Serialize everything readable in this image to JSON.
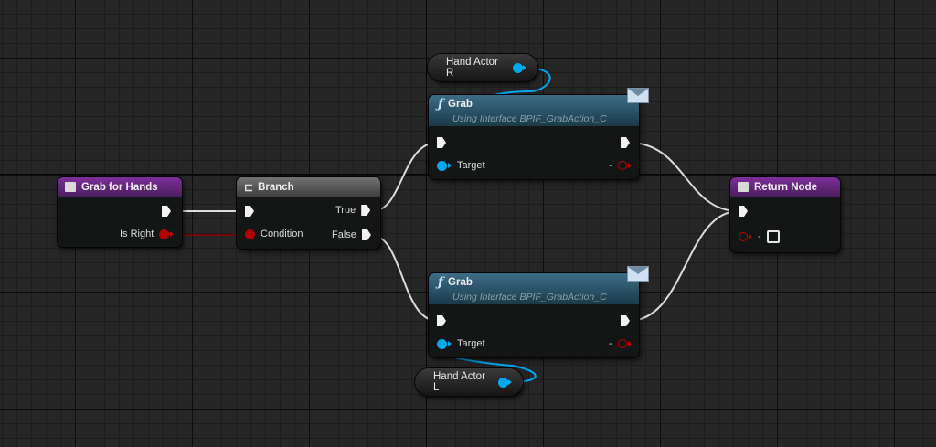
{
  "nodes": {
    "grab_for_hands": {
      "title": "Grab for Hands",
      "is_right_label": "Is Right"
    },
    "branch": {
      "title": "Branch",
      "condition_label": "Condition",
      "true_label": "True",
      "false_label": "False"
    },
    "grab_top": {
      "func_glyph": "ƒ",
      "title": "Grab",
      "subtitle": "Using Interface BPIF_GrabAction_C",
      "target_label": "Target",
      "return_label": "-"
    },
    "grab_bottom": {
      "func_glyph": "ƒ",
      "title": "Grab",
      "subtitle": "Using Interface BPIF_GrabAction_C",
      "target_label": "Target",
      "return_label": "-"
    },
    "return_node": {
      "title": "Return Node",
      "value_label": "-"
    },
    "hand_actor_r": {
      "label": "Hand Actor R"
    },
    "hand_actor_l": {
      "label": "Hand Actor L"
    }
  },
  "colors": {
    "exec_wire": "#e0e0e0",
    "object_wire": "#00a8f0",
    "bool_wire": "#9a0000",
    "function_header": "#7e2e9c",
    "call_header": "#3d6d85"
  },
  "icons": {
    "function_entry": "function-entry-icon",
    "branch": "branch-icon",
    "interface_call": "function-icon",
    "message": "envelope-icon"
  }
}
